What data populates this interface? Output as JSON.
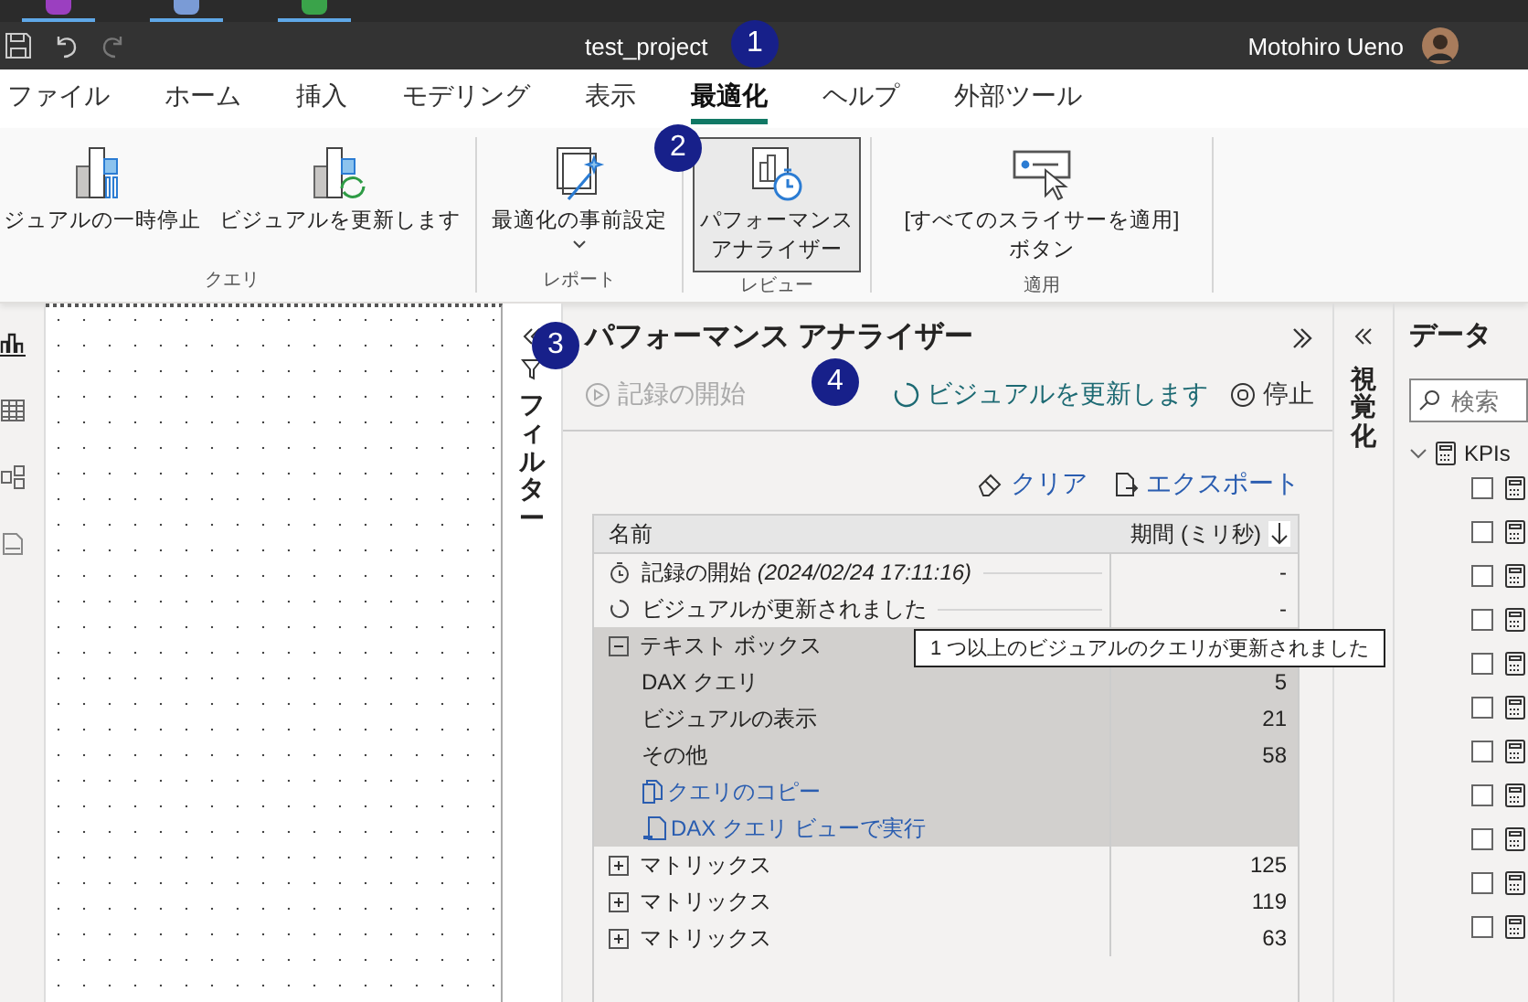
{
  "title_bar": {
    "title": "test_project",
    "user": "Motohiro Ueno"
  },
  "menu_tabs": [
    {
      "label": "ファイル",
      "selected": false
    },
    {
      "label": "ホーム",
      "selected": false
    },
    {
      "label": "挿入",
      "selected": false
    },
    {
      "label": "モデリング",
      "selected": false
    },
    {
      "label": "表示",
      "selected": false
    },
    {
      "label": "最適化",
      "selected": true
    },
    {
      "label": "ヘルプ",
      "selected": false
    },
    {
      "label": "外部ツール",
      "selected": false
    }
  ],
  "ribbon": {
    "groups": [
      {
        "label": "クエリ",
        "buttons": [
          {
            "kind": "pause",
            "label": "ジュアルの一時停止",
            "selected": false
          },
          {
            "kind": "refresh",
            "label": "ビジュアルを更新します",
            "selected": false
          }
        ]
      },
      {
        "label": "レポート",
        "buttons": [
          {
            "kind": "presets",
            "label": "最適化の事前設定",
            "selected": false
          }
        ]
      },
      {
        "label": "レビュー",
        "buttons": [
          {
            "kind": "analyzer",
            "label": "パフォーマンスアナライザー",
            "selected": true
          }
        ]
      },
      {
        "label": "適用",
        "buttons": [
          {
            "kind": "slicer",
            "label": "[すべてのスライサーを適用] ボタン",
            "selected": false
          }
        ]
      }
    ]
  },
  "views": [
    {
      "kind": "report",
      "selected": true
    },
    {
      "kind": "table",
      "selected": false
    },
    {
      "kind": "model",
      "selected": false
    },
    {
      "kind": "dax",
      "selected": false
    }
  ],
  "filter_pane": {
    "label": "フィルター"
  },
  "performance_analyzer": {
    "title": "パフォーマンス アナライザー",
    "actions": [
      {
        "kind": "start",
        "label": "記録の開始",
        "disabled": true
      },
      {
        "kind": "refresh",
        "label": "ビジュアルを更新します",
        "disabled": false
      },
      {
        "kind": "stop",
        "label": "停止",
        "disabled": false
      }
    ],
    "tools": [
      {
        "kind": "clear",
        "label": "クリア"
      },
      {
        "kind": "export",
        "label": "エクスポート"
      }
    ],
    "columns": [
      "名前",
      "期間 (ミリ秒)"
    ],
    "rows": [
      {
        "kind": "start_event",
        "name": "記録の開始 *(2024/02/24 17:11:16)*",
        "duration": "-"
      },
      {
        "kind": "refresh_event",
        "name": "ビジュアルが更新されました",
        "duration": "-"
      },
      {
        "kind": "group",
        "name": "テキスト ボックス",
        "expanded": true,
        "selected": true,
        "children": [
          {
            "kind": "metric",
            "name": "DAX クエリ",
            "duration": "5"
          },
          {
            "kind": "metric",
            "name": "ビジュアルの表示",
            "duration": "21"
          },
          {
            "kind": "metric",
            "name": "その他",
            "duration": "58"
          },
          {
            "kind": "copy_link",
            "name": "クエリのコピー"
          },
          {
            "kind": "dax_link",
            "name": "DAX クエリ ビューで実行"
          }
        ]
      },
      {
        "kind": "group",
        "name": "マトリックス",
        "expanded": false,
        "selected": false,
        "duration": "125"
      },
      {
        "kind": "group",
        "name": "マトリックス",
        "expanded": false,
        "selected": false,
        "duration": "119"
      },
      {
        "kind": "group",
        "name": "マトリックス",
        "expanded": false,
        "selected": false,
        "duration": "63"
      }
    ],
    "tooltip": "1 つ以上のビジュアルのクエリが更新されました"
  },
  "visuals_pane": {
    "label": "視覚化"
  },
  "data_pane": {
    "title": "データ",
    "search": {
      "placeholder": "検索"
    },
    "tree": {
      "name": "KPIs",
      "expanded": true,
      "children": [
        {
          "checked": false
        },
        {
          "checked": false
        },
        {
          "checked": false
        },
        {
          "checked": false
        },
        {
          "checked": false
        },
        {
          "checked": false
        },
        {
          "checked": false
        },
        {
          "checked": false
        },
        {
          "checked": false
        },
        {
          "checked": false
        },
        {
          "checked": false
        }
      ]
    }
  },
  "badges": [
    "1",
    "2",
    "3",
    "4"
  ]
}
